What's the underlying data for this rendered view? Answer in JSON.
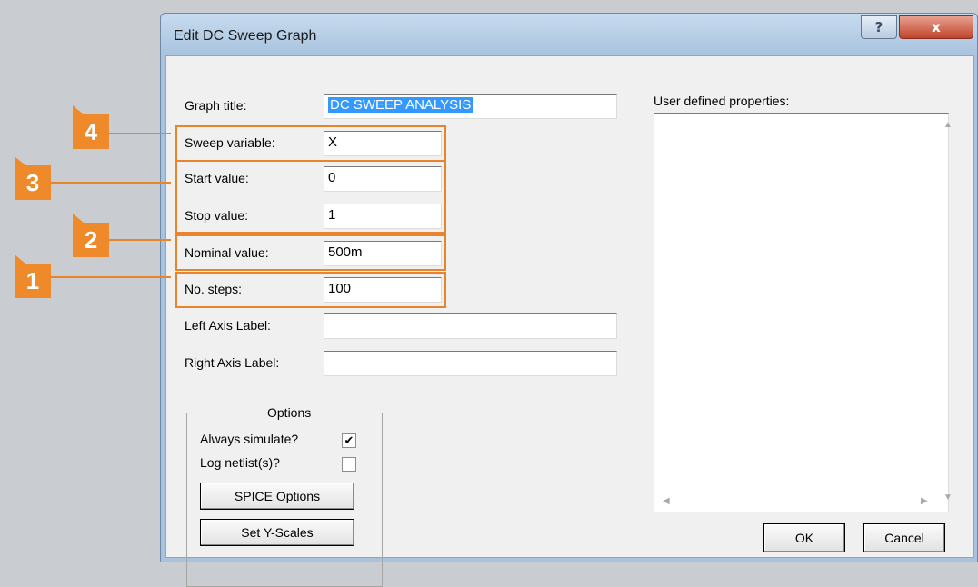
{
  "window": {
    "title": "Edit DC Sweep Graph",
    "help_label": "?",
    "close_label": "x"
  },
  "fields": {
    "graph_title": {
      "label": "Graph title:",
      "value": "DC SWEEP ANALYSIS"
    },
    "sweep_variable": {
      "label": "Sweep variable:",
      "value": "X"
    },
    "start_value": {
      "label": "Start value:",
      "value": "0"
    },
    "stop_value": {
      "label": "Stop value:",
      "value": "1"
    },
    "nominal_value": {
      "label": "Nominal value:",
      "value": "500m"
    },
    "no_steps": {
      "label": "No. steps:",
      "value": "100"
    },
    "left_axis_label": {
      "label": "Left Axis Label:",
      "value": ""
    },
    "right_axis_label": {
      "label": "Right Axis Label:",
      "value": ""
    }
  },
  "options": {
    "title": "Options",
    "always_simulate": {
      "label": "Always simulate?",
      "checked": true,
      "mark": "✔"
    },
    "log_netlists": {
      "label": "Log netlist(s)?",
      "checked": false
    },
    "spice_options_label": "SPICE Options",
    "set_y_scales_label": "Set Y-Scales"
  },
  "user_properties": {
    "label": "User defined properties:",
    "value": ""
  },
  "buttons": {
    "ok": "OK",
    "cancel": "Cancel"
  },
  "callouts": [
    "4",
    "3",
    "2",
    "1"
  ],
  "colors": {
    "callout": "#ef8a2a",
    "selection": "#3399ff"
  }
}
